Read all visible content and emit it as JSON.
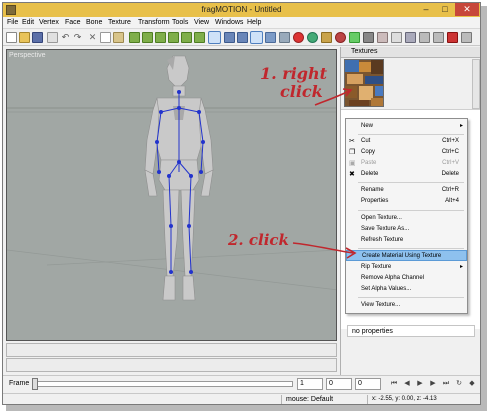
{
  "window": {
    "title": "fragMOTION - Untitled",
    "minimize": "–",
    "maximize": "□",
    "close": "✕"
  },
  "menu": [
    "File",
    "Edit",
    "Vertex",
    "Face",
    "Bone",
    "Texture",
    "Transform",
    "Tools",
    "View",
    "Windows",
    "Help"
  ],
  "viewport": {
    "label": "Perspective"
  },
  "textures_panel": {
    "title": "Textures",
    "properties_text": "no properties"
  },
  "context_menu": [
    {
      "label": "New",
      "submenu": true
    },
    {
      "label": "Cut",
      "shortcut": "Ctrl+X",
      "icon": "scissors-icon"
    },
    {
      "label": "Copy",
      "shortcut": "Ctrl+C",
      "icon": "copy-icon"
    },
    {
      "label": "Paste",
      "shortcut": "Ctrl+V",
      "icon": "paste-icon",
      "disabled": true
    },
    {
      "label": "Delete",
      "shortcut": "Delete",
      "icon": "delete-x-icon"
    },
    {
      "label": "Rename",
      "shortcut": "Ctrl+R"
    },
    {
      "label": "Properties",
      "shortcut": "Alt+4"
    },
    {
      "label": "Open Texture..."
    },
    {
      "label": "Save Texture As..."
    },
    {
      "label": "Refresh Texture"
    },
    {
      "label": "Create Material Using Texture",
      "highlighted": true
    },
    {
      "label": "Rip Texture",
      "submenu": true
    },
    {
      "label": "Remove Alpha Channel"
    },
    {
      "label": "Set Alpha Values..."
    },
    {
      "label": "View Texture..."
    }
  ],
  "frame_bar": {
    "label": "Frame",
    "value1": "1",
    "value2": "0",
    "value3": "0"
  },
  "status_bar": {
    "mouse_mode": "mouse: Default",
    "coords": "x: -2.55, y: 0.00, z: -4.13"
  },
  "annotations": {
    "step1_line1": "1. right",
    "step1_line2": "click",
    "step2": "2. click"
  },
  "colors": {
    "titlebar": "#e8c04a",
    "viewport_bg": "#a1a7a4",
    "highlight": "#8ec1ee",
    "annotation_red": "#c0272d",
    "skeleton_blue": "#2233cc"
  }
}
